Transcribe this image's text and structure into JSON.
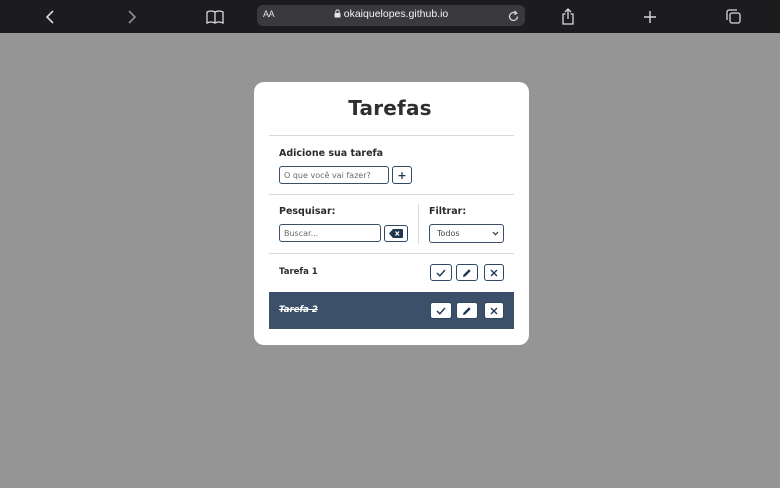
{
  "browser": {
    "address": {
      "text_size_label": "AA",
      "host": "okaiquelopes.github.io"
    }
  },
  "app": {
    "title": "Tarefas",
    "add": {
      "label": "Adicione sua tarefa",
      "placeholder": "O que você vai fazer?",
      "button_label": "+"
    },
    "search": {
      "label": "Pesquisar:",
      "placeholder": "Buscar..."
    },
    "filter": {
      "label": "Filtrar:",
      "selected": "Todos"
    },
    "todos": [
      {
        "name": "Tarefa 1",
        "done": false
      },
      {
        "name": "Tarefa 2",
        "done": true
      }
    ]
  },
  "colors": {
    "accent": "#3c5169",
    "page_bg": "#959595",
    "card_bg": "#ffffff"
  },
  "icons": [
    "chevron-left-icon",
    "chevron-right-icon",
    "book-icon",
    "lock-icon",
    "reload-icon",
    "share-icon",
    "plus-icon",
    "tabs-icon",
    "backspace-icon",
    "check-icon",
    "pencil-icon",
    "x-icon",
    "chevron-down-icon"
  ]
}
